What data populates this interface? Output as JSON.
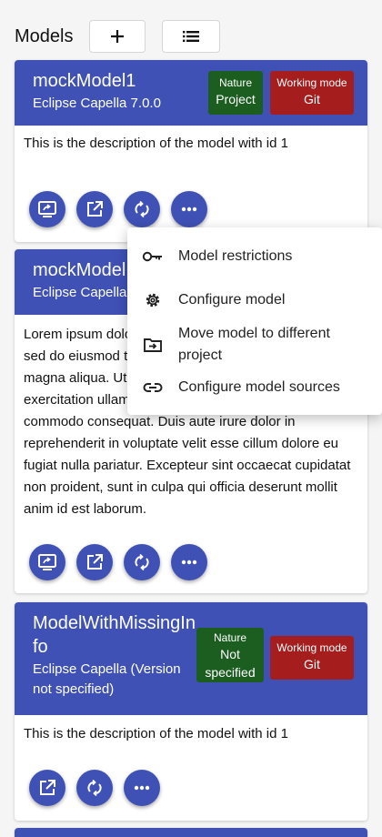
{
  "header": {
    "title": "Models"
  },
  "cards": [
    {
      "title": "mockModel1",
      "subtitle": "Eclipse Capella 7.0.0",
      "nature": {
        "label": "Nature",
        "value": "Project"
      },
      "mode": {
        "label": "Working mode",
        "value": "Git"
      },
      "description": "This is the description of the model with id 1"
    },
    {
      "title": "mockModel",
      "subtitle": "Eclipse Capella",
      "description": "Lorem ipsum dolor sit amet, consectetur adipiscing elit, sed do eiusmod tempor incididunt ut labore et dolore magna aliqua. Ut enim ad minim veniam, quis nostrud exercitation ullamco laboris nisi ut aliquip ex ea commodo consequat. Duis aute irure dolor in reprehenderit in voluptate velit esse cillum dolore eu fugiat nulla pariatur. Excepteur sint occaecat cupidatat non proident, sunt in culpa qui officia deserunt mollit anim id est laborum."
    },
    {
      "title": "ModelWithMissingInfo",
      "subtitle": "Eclipse Capella (Version not specified)",
      "nature": {
        "label": "Nature",
        "value": "Not specified"
      },
      "mode": {
        "label": "Working mode",
        "value": "Git"
      },
      "description": "This is the description of the model with id 1"
    }
  ],
  "menu": {
    "items": [
      {
        "label": "Model restrictions",
        "icon": "key-icon"
      },
      {
        "label": "Configure model",
        "icon": "gear-icon"
      },
      {
        "label": "Move model to different project",
        "icon": "folder-move-icon"
      },
      {
        "label": "Configure model sources",
        "icon": "link-icon"
      }
    ]
  },
  "colors": {
    "primary": "#3f51b5",
    "nature_badge": "#1b5e20",
    "mode_badge": "#a51d1d"
  }
}
